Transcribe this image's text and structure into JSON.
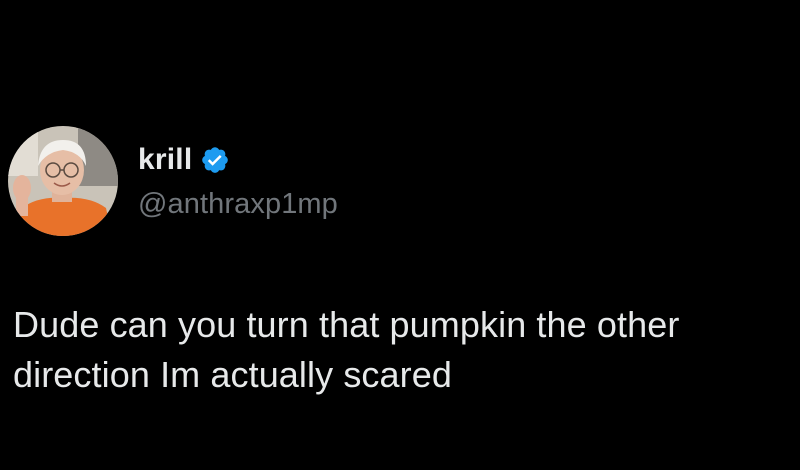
{
  "tweet": {
    "author": {
      "display_name": "krill",
      "handle": "@anthraxp1mp",
      "verified": true,
      "verified_color": "#1d9bf0",
      "avatar_icon": "avatar-photo"
    },
    "text": "Dude can you turn that pumpkin the other direction Im actually scared"
  },
  "colors": {
    "background": "#000000",
    "primary_text": "#e7e9ea",
    "secondary_text": "#71767b",
    "accent": "#1d9bf0"
  }
}
